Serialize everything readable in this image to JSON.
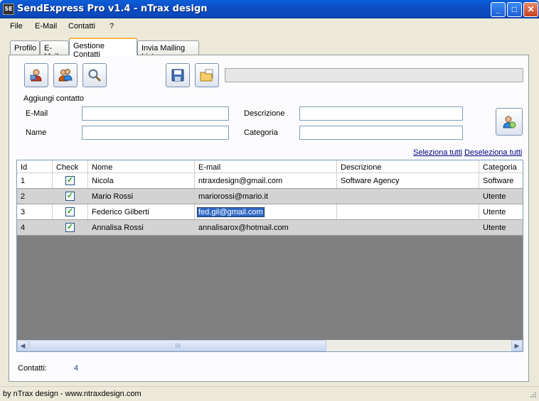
{
  "window": {
    "title": "SendExpress Pro v1.4 - nTrax design",
    "icon_text": "SE"
  },
  "menu": [
    "File",
    "E-Mail",
    "Contatti",
    "?"
  ],
  "tabs": [
    "Profilo",
    "E-Mail",
    "Gestione Contatti",
    "Invia Mailing List"
  ],
  "toolbar": {
    "icons": [
      "add-contact-icon",
      "group-contacts-icon",
      "search-icon",
      "save-icon",
      "open-folder-icon"
    ],
    "progress": 0
  },
  "form": {
    "section_title": "Aggiungi contatto",
    "email_label": "E-Mail",
    "name_label": "Name",
    "description_label": "Descrizione",
    "category_label": "Categoria",
    "email_value": "",
    "name_value": "",
    "description_value": "",
    "category_value": ""
  },
  "links": {
    "select_all": "Seleziona tutti",
    "deselect_all": "Deseleziona tutti"
  },
  "grid": {
    "columns": [
      "Id",
      "Check",
      "Nome",
      "E-mail",
      "Descrizione",
      "Categoria"
    ],
    "rows": [
      {
        "id": "1",
        "checked": true,
        "nome": "Nicola",
        "email": "ntraxdesign@gmail.com",
        "descrizione": "Software Agency",
        "categoria": "Software"
      },
      {
        "id": "2",
        "checked": true,
        "nome": "Mario Rossi",
        "email": "mariorossi@mario.it",
        "descrizione": "",
        "categoria": "Utente"
      },
      {
        "id": "3",
        "checked": true,
        "nome": "Federico Gilberti",
        "email": "fed.gil@gmail.com",
        "descrizione": "",
        "categoria": "Utente"
      },
      {
        "id": "4",
        "checked": true,
        "nome": "Annalisa Rossi",
        "email": "annalisarox@hotmail.com",
        "descrizione": "",
        "categoria": "Utente"
      }
    ],
    "check_mark": "✓",
    "thumb_grip": "III"
  },
  "count": {
    "label": "Contatti:",
    "value": "4"
  },
  "status": {
    "text": "by nTrax design - www.ntraxdesign.com"
  },
  "colors": {
    "title_bar": "#0a5fd8",
    "row_alt": "#d3d3d3",
    "selection": "#316ac5",
    "grid_empty": "#808080",
    "tab_highlight": "#f5b545",
    "link": "#00007f"
  }
}
